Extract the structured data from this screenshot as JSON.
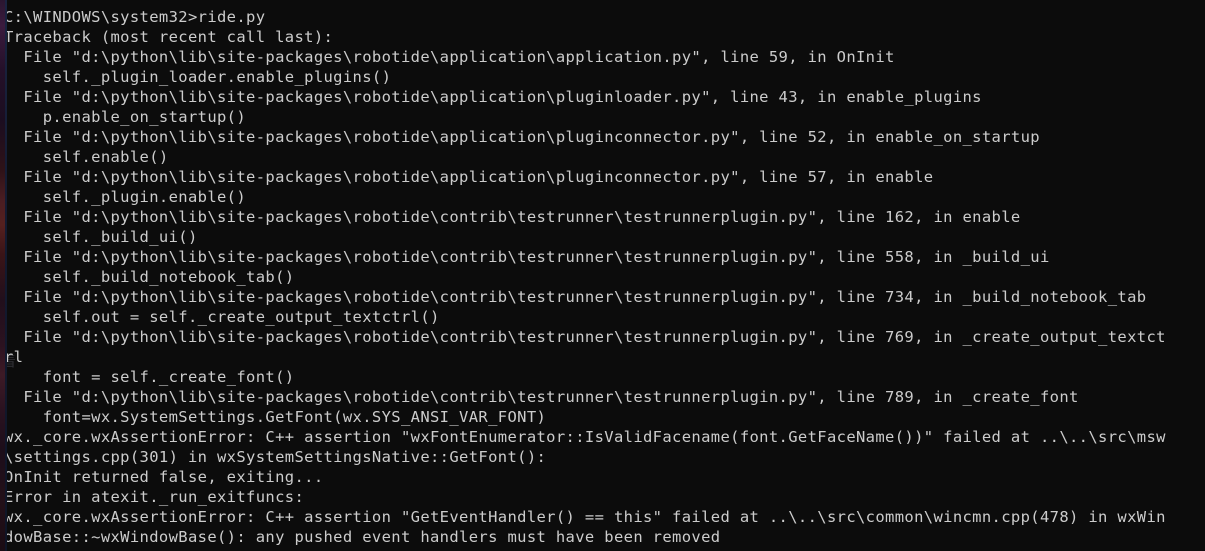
{
  "window": {
    "app": "Command Prompt",
    "shell_prompt": "C:\\WINDOWS\\system32>",
    "command": "ride.py",
    "background_color": "#0c0c0c",
    "text_color": "#cccccc"
  },
  "artifact": {
    "name": "window-edge-gradient",
    "colors": [
      "#3a1b3e",
      "#55201f",
      "#2b1220"
    ],
    "watermark_glyph": "着"
  },
  "terminal": {
    "columns": 122,
    "rows": 27,
    "lines": [
      "C:\\WINDOWS\\system32>ride.py",
      "Traceback (most recent call last):",
      "  File \"d:\\python\\lib\\site-packages\\robotide\\application\\application.py\", line 59, in OnInit",
      "    self._plugin_loader.enable_plugins()",
      "  File \"d:\\python\\lib\\site-packages\\robotide\\application\\pluginloader.py\", line 43, in enable_plugins",
      "    p.enable_on_startup()",
      "  File \"d:\\python\\lib\\site-packages\\robotide\\application\\pluginconnector.py\", line 52, in enable_on_startup",
      "    self.enable()",
      "  File \"d:\\python\\lib\\site-packages\\robotide\\application\\pluginconnector.py\", line 57, in enable",
      "    self._plugin.enable()",
      "  File \"d:\\python\\lib\\site-packages\\robotide\\contrib\\testrunner\\testrunnerplugin.py\", line 162, in enable",
      "    self._build_ui()",
      "  File \"d:\\python\\lib\\site-packages\\robotide\\contrib\\testrunner\\testrunnerplugin.py\", line 558, in _build_ui",
      "    self._build_notebook_tab()",
      "  File \"d:\\python\\lib\\site-packages\\robotide\\contrib\\testrunner\\testrunnerplugin.py\", line 734, in _build_notebook_tab",
      "    self.out = self._create_output_textctrl()",
      "  File \"d:\\python\\lib\\site-packages\\robotide\\contrib\\testrunner\\testrunnerplugin.py\", line 769, in _create_output_textct",
      "rl",
      "    font = self._create_font()",
      "  File \"d:\\python\\lib\\site-packages\\robotide\\contrib\\testrunner\\testrunnerplugin.py\", line 789, in _create_font",
      "    font=wx.SystemSettings.GetFont(wx.SYS_ANSI_VAR_FONT)",
      "wx._core.wxAssertionError: C++ assertion \"wxFontEnumerator::IsValidFacename(font.GetFaceName())\" failed at ..\\..\\src\\msw",
      "\\settings.cpp(301) in wxSystemSettingsNative::GetFont():",
      "OnInit returned false, exiting...",
      "Error in atexit._run_exitfuncs:",
      "wx._core.wxAssertionError: C++ assertion \"GetEventHandler() == this\" failed at ..\\..\\src\\common\\wincmn.cpp(478) in wxWin",
      "dowBase::~wxWindowBase(): any pushed event handlers must have been removed"
    ]
  }
}
